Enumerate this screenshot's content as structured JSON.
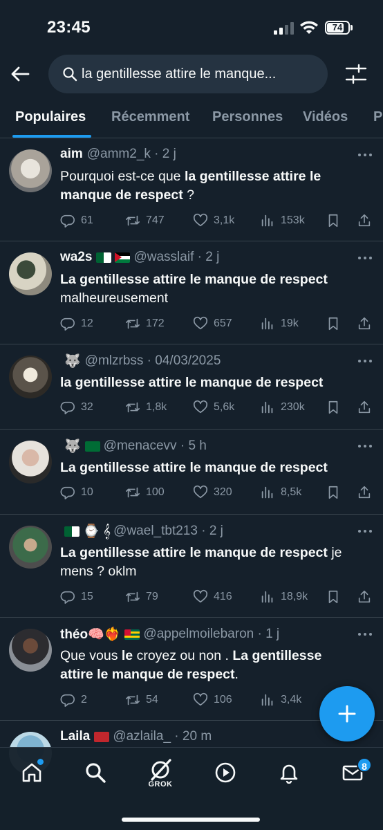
{
  "status_bar": {
    "time": "23:45",
    "battery": "74"
  },
  "search": {
    "query": "la gentillesse attire le manque..."
  },
  "tabs": [
    {
      "label": "Populaires",
      "active": true
    },
    {
      "label": "Récemment"
    },
    {
      "label": "Personnes"
    },
    {
      "label": "Vidéos"
    },
    {
      "label": "P"
    }
  ],
  "tweets": [
    {
      "name": "aim",
      "meta": "@amm2_k · 2 j",
      "text_parts": [
        [
          "Pourquoi est-ce que ",
          false
        ],
        [
          "la gentillesse attire le manque de respect",
          true
        ],
        [
          " ?",
          false
        ]
      ],
      "stats": {
        "replies": "61",
        "retweets": "747",
        "likes": "3,1k",
        "views": "153k"
      }
    },
    {
      "name": "wa2s",
      "flags": [
        "dz",
        "ps"
      ],
      "meta": "@wasslaif · 2 j",
      "text_parts": [
        [
          "La gentillesse attire le manque de respect",
          true
        ],
        [
          " malheureusement",
          false
        ]
      ],
      "stats": {
        "replies": "12",
        "retweets": "172",
        "likes": "657",
        "views": "19k"
      }
    },
    {
      "name": "",
      "emoji": "🐺",
      "meta": "@mlzrbss · 04/03/2025",
      "text_parts": [
        [
          "la gentillesse attire le manque de respect",
          true
        ]
      ],
      "stats": {
        "replies": "32",
        "retweets": "1,8k",
        "likes": "5,6k",
        "views": "230k"
      }
    },
    {
      "name": "",
      "emoji": "🐺",
      "flags": [
        "sa"
      ],
      "meta": "@menacevv · 5 h",
      "text_parts": [
        [
          "La gentillesse attire le manque de respect",
          true
        ]
      ],
      "stats": {
        "replies": "10",
        "retweets": "100",
        "likes": "320",
        "views": "8,5k"
      }
    },
    {
      "name": "",
      "flags": [
        "dz"
      ],
      "emoji": "⌚ 𝄞",
      "meta": "@wael_tbt213 · 2 j",
      "text_parts": [
        [
          "La gentillesse attire le manque de respect",
          true
        ],
        [
          " je mens ? oklm",
          false
        ]
      ],
      "stats": {
        "replies": "15",
        "retweets": "79",
        "likes": "416",
        "views": "18,9k"
      }
    },
    {
      "name": "théo🧠❤️‍🔥",
      "flags": [
        "tg"
      ],
      "meta": "@appelmoilebaron · 1 j",
      "text_parts": [
        [
          "Que vous ",
          false
        ],
        [
          "le",
          true
        ],
        [
          " croyez ou non . ",
          false
        ],
        [
          "La gentillesse attire le manque de respect",
          true
        ],
        [
          ".",
          false
        ]
      ],
      "stats": {
        "replies": "2",
        "retweets": "54",
        "likes": "106",
        "views": "3,4k"
      }
    },
    {
      "name": "Laila",
      "flags": [
        "ma"
      ],
      "meta": "@azlaila_ · 20 m",
      "text_parts": [],
      "stats": null
    }
  ],
  "nav": {
    "grok_label": "GROK",
    "messages_badge": "8"
  },
  "colors": {
    "background": "#15202b",
    "accent": "#1d9bf0",
    "muted": "#8b98a5",
    "divider": "#38444d"
  }
}
